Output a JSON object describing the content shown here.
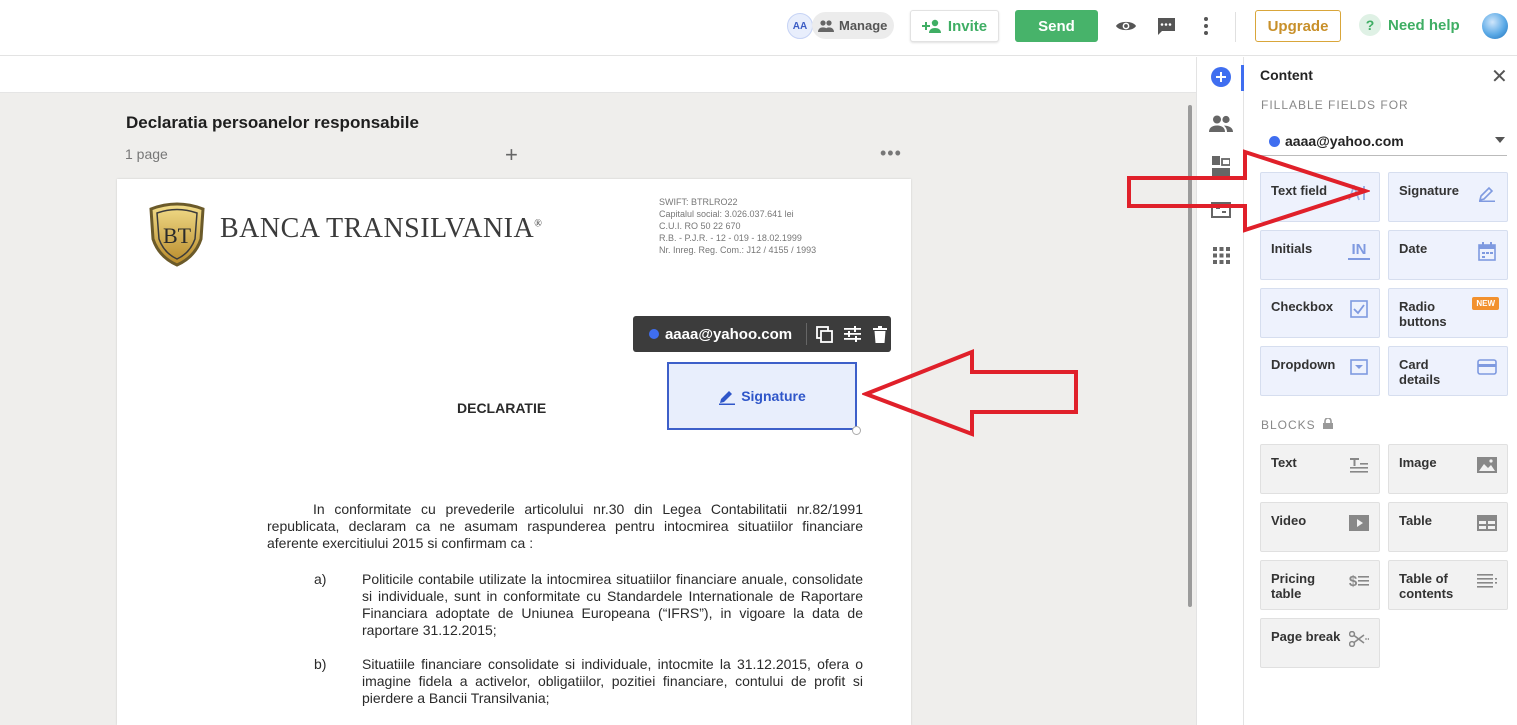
{
  "topbar": {
    "avatar_initials": "AA",
    "manage_label": "Manage",
    "invite_label": "Invite",
    "send_label": "Send",
    "upgrade_label": "Upgrade",
    "help_label": "Need help",
    "help_symbol": "?",
    "accent_green": "#47b36a"
  },
  "document": {
    "title": "Declaratia persoanelor responsabile",
    "page_count": "1 page",
    "add_symbol": "+",
    "more_symbol": "•••"
  },
  "page": {
    "bank_name": "BANCA TRANSILVANIA",
    "bank_name_mark": "®",
    "logo_text": "BT",
    "bank_info": "SWIFT: BTRLRO22\nCapitalul social: 3.026.037.641 lei\nC.U.I. RO 50 22 670\nR.B. - P.J.R. - 12 - 019 - 18.02.1999\nNr. Inreg. Reg. Com.: J12 / 4155 / 1993",
    "heading": "DECLARATIE",
    "intro": "In conformitate cu prevederile articolului nr.30 din Legea Contabilitatii nr.82/1991 republicata, declaram ca ne asumam raspunderea pentru intocmirea situatiilor financiare aferente exercitiului 2015 si confirmam ca :",
    "items": [
      {
        "letter": "a)",
        "text": "Politicile contabile utilizate la intocmirea situatiilor financiare anuale, consolidate si individuale, sunt in conformitate cu Standardele Internationale de Raportare Financiara adoptate de Uniunea Europeana (“IFRS”), in vigoare la data de raportare 31.12.2015;"
      },
      {
        "letter": "b)",
        "text": "Situatiile financiare consolidate si individuale, intocmite la 31.12.2015, ofera o imagine fidela a activelor, obligatiilor, pozitiei financiare, contului de profit si pierdere a Bancii Transilvania;"
      }
    ]
  },
  "signature_field": {
    "assignee": "aaaa@yahoo.com",
    "label": "Signature"
  },
  "panel": {
    "title": "Content",
    "close_symbol": "✕",
    "fillable_heading": "FILLABLE FIELDS FOR",
    "recipient": "aaaa@yahoo.com",
    "fields": [
      {
        "label": "Text field",
        "icon": "text-field-icon"
      },
      {
        "label": "Signature",
        "icon": "signature-pen-icon"
      },
      {
        "label": "Initials",
        "icon": "initials-icon",
        "icon_text": "IN"
      },
      {
        "label": "Date",
        "icon": "calendar-icon"
      },
      {
        "label": "Checkbox",
        "icon": "checkbox-icon"
      },
      {
        "label": "Radio buttons",
        "icon": "radio-icon",
        "badge": "NEW"
      },
      {
        "label": "Dropdown",
        "icon": "dropdown-icon"
      },
      {
        "label": "Card details",
        "icon": "card-icon"
      }
    ],
    "blocks_heading": "BLOCKS",
    "blocks": [
      {
        "label": "Text",
        "icon": "text-block-icon"
      },
      {
        "label": "Image",
        "icon": "image-icon"
      },
      {
        "label": "Video",
        "icon": "video-icon"
      },
      {
        "label": "Table",
        "icon": "table-icon"
      },
      {
        "label": "Pricing table",
        "icon": "pricing-table-icon"
      },
      {
        "label": "Table of contents",
        "icon": "toc-icon"
      },
      {
        "label": "Page break",
        "icon": "scissors-icon"
      }
    ],
    "field_tile_bg": "#eef2fd",
    "recipient_color": "#3f6ef0"
  },
  "annotation_color": "#e0202a"
}
